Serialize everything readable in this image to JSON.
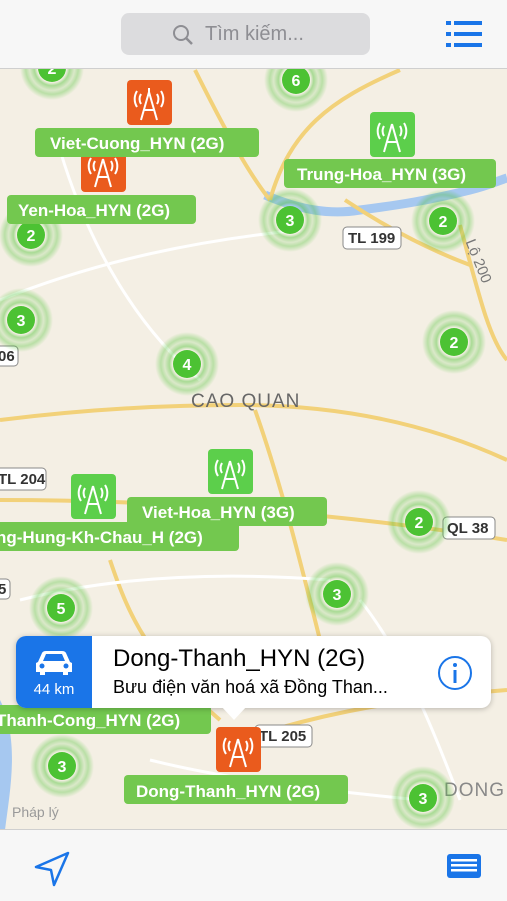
{
  "search": {
    "placeholder": "Tìm kiếm..."
  },
  "map": {
    "area_label": "CAO QUAN",
    "area_label_2": "DONG",
    "place_label": "Pháp lý",
    "roads": [
      "TL 199",
      "Lộ 200",
      "TL 204",
      "QL 38",
      "TL 205",
      "06",
      "5",
      "6"
    ],
    "stations": [
      {
        "name": "Viet-Cuong_HYN (2G)",
        "type": "2G"
      },
      {
        "name": "Yen-Hoa_HYN (2G)",
        "type": "2G"
      },
      {
        "name": "Trung-Hoa_HYN (3G)",
        "type": "3G"
      },
      {
        "name": "Viet-Hoa_HYN (3G)",
        "type": "3G"
      },
      {
        "name": "ng-Hung-Kh-Chau_H (2G)",
        "type": "3G"
      },
      {
        "name": "Thanh-Cong_HYN (2G)",
        "type": "2G"
      },
      {
        "name": "Dong-Thanh_HYN (2G)",
        "type": "2G"
      }
    ],
    "clusters": [
      "2",
      "6",
      "3",
      "2",
      "2",
      "3",
      "2",
      "4",
      "2",
      "5",
      "3",
      "3",
      "3"
    ]
  },
  "callout": {
    "distance": "44 km",
    "title": "Dong-Thanh_HYN (2G)",
    "subtitle": "Bưu điện văn hoá xã Đồng Than..."
  },
  "colors": {
    "accent": "#1a75e8",
    "cluster": "#4cc233",
    "tower2g": "#ea5b1d",
    "tower3g": "#5ccf4b",
    "label_bg": "#73c84f"
  },
  "icons": {
    "search": "search-icon",
    "menu": "list-icon",
    "location": "location-arrow-icon",
    "list": "card-list-icon",
    "car": "car-icon",
    "info": "info-icon"
  }
}
